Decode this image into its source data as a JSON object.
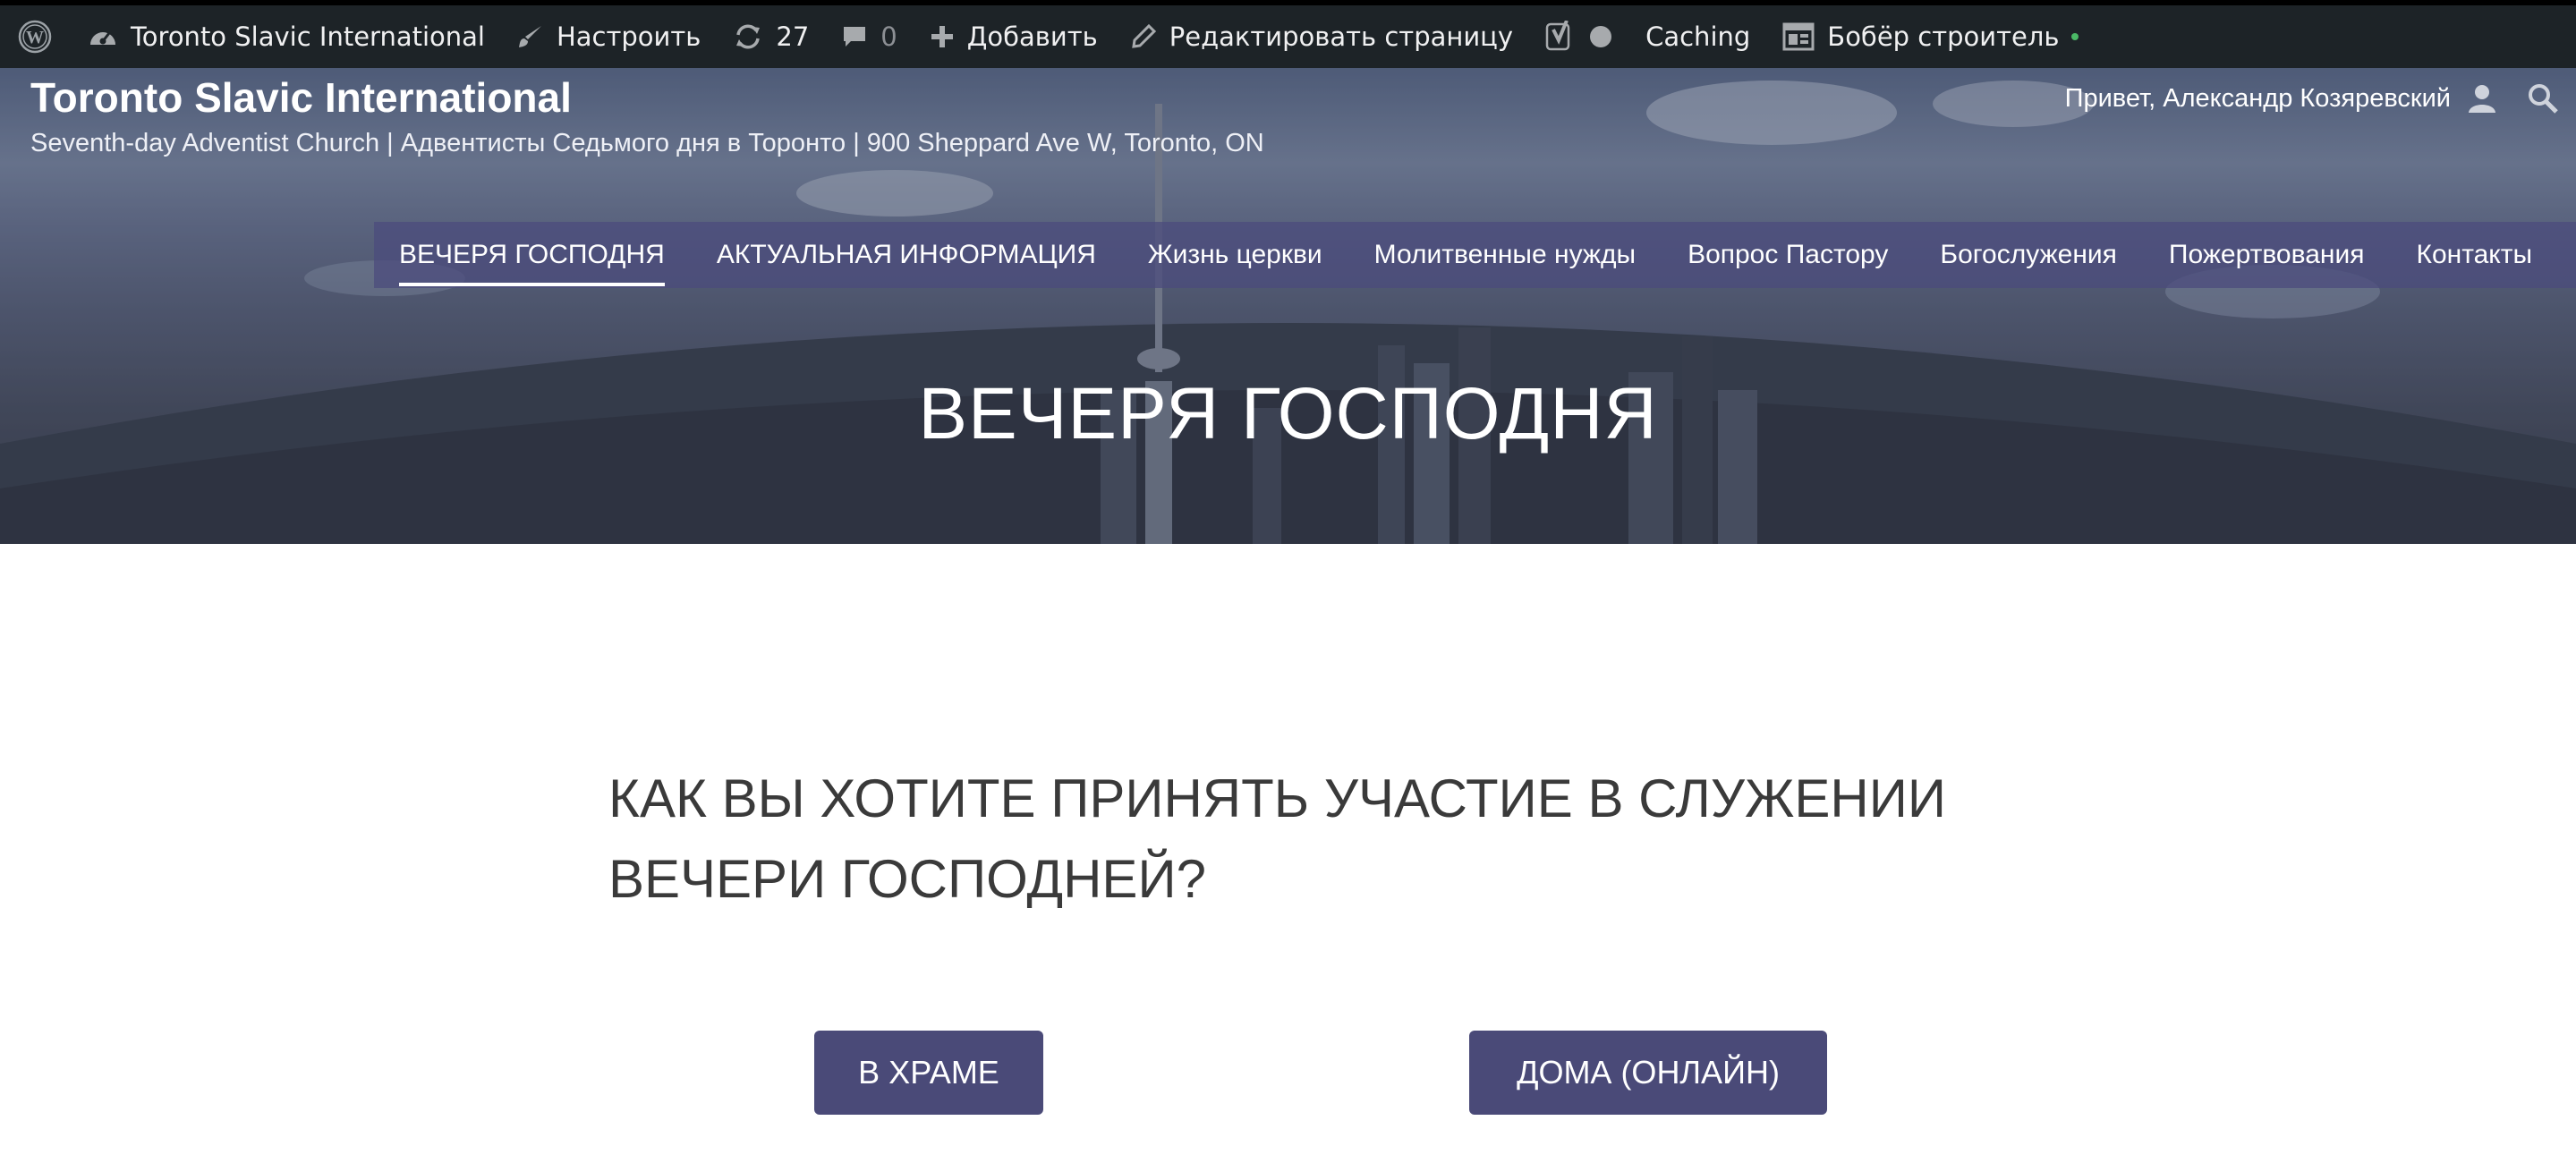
{
  "admin_bar": {
    "site_name": "Toronto Slavic International",
    "customize": "Настроить",
    "updates_count": "27",
    "comments_count": "0",
    "add_new": "Добавить",
    "edit_page": "Редактировать страницу",
    "caching": "Caching",
    "builder": "Бобёр строитель",
    "builder_status_color": "#4ab866"
  },
  "site": {
    "title": "Toronto Slavic International",
    "description": "Seventh-day Adventist Church | Адвентисты Седьмого дня в Торонто | 900 Sheppard Ave W, Toronto, ON",
    "greeting": "Привет, Александр Козяревский"
  },
  "nav": {
    "items": [
      {
        "label": "ВЕЧЕРЯ ГОСПОДНЯ",
        "active": true
      },
      {
        "label": "АКТУАЛЬНАЯ ИНФОРМАЦИЯ"
      },
      {
        "label": "Жизнь церкви"
      },
      {
        "label": "Молитвенные нужды"
      },
      {
        "label": "Вопрос Пастору"
      },
      {
        "label": "Богослужения"
      },
      {
        "label": "Пожертвования"
      },
      {
        "label": "Контакты"
      }
    ]
  },
  "hero": {
    "page_title": "ВЕЧЕРЯ ГОСПОДНЯ"
  },
  "content": {
    "question": "КАК ВЫ ХОТИТЕ ПРИНЯТЬ УЧАСТИЕ В СЛУЖЕНИИ ВЕЧЕРИ ГОСПОДНЕЙ?",
    "button_temple": "В ХРАМЕ",
    "button_online": "ДОМА (ОНЛАЙН)"
  },
  "colors": {
    "admin_bar_bg": "#1d2327",
    "nav_bg": "#4b4b7d",
    "button_bg": "#4a4a78",
    "heading_text": "#3a3a3a"
  },
  "icons": [
    "wordpress-logo-icon",
    "dashboard-icon",
    "brush-icon",
    "updates-icon",
    "comment-icon",
    "plus-icon",
    "pencil-icon",
    "yoast-icon",
    "status-circle-icon",
    "builder-icon",
    "user-icon",
    "search-icon"
  ]
}
